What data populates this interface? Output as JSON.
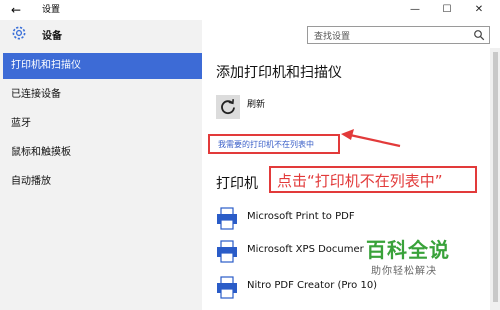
{
  "window": {
    "title": "设置",
    "back_glyph": "←",
    "minimize_glyph": "—",
    "maximize_glyph": "☐",
    "close_glyph": "✕"
  },
  "sidebar": {
    "header": "设备",
    "header_icon": "gear-icon",
    "items": [
      {
        "label": "打印机和扫描仪",
        "active": true
      },
      {
        "label": "已连接设备",
        "active": false
      },
      {
        "label": "蓝牙",
        "active": false
      },
      {
        "label": "鼠标和触摸板",
        "active": false
      },
      {
        "label": "自动播放",
        "active": false
      }
    ],
    "active_color": "#3d6bd6"
  },
  "search": {
    "placeholder": "查找设置",
    "icon": "search-icon"
  },
  "main": {
    "title": "添加打印机和扫描仪",
    "refresh_label": "刷新",
    "refresh_icon": "refresh-icon",
    "not_listed_link": "我需要的打印机不在列表中",
    "printers_title": "打印机",
    "printers": [
      {
        "name": "Microsoft Print to PDF",
        "icon": "printer-icon"
      },
      {
        "name": "Microsoft XPS Documer",
        "icon": "printer-icon"
      },
      {
        "name": "Nitro PDF Creator (Pro 10)",
        "icon": "printer-icon"
      }
    ]
  },
  "annotation": {
    "callout_text": "点击“打印机不在列表中”",
    "highlight_color": "#e23a3a"
  },
  "watermark": {
    "title": "百科全说",
    "subtitle": "助你轻松解决"
  }
}
